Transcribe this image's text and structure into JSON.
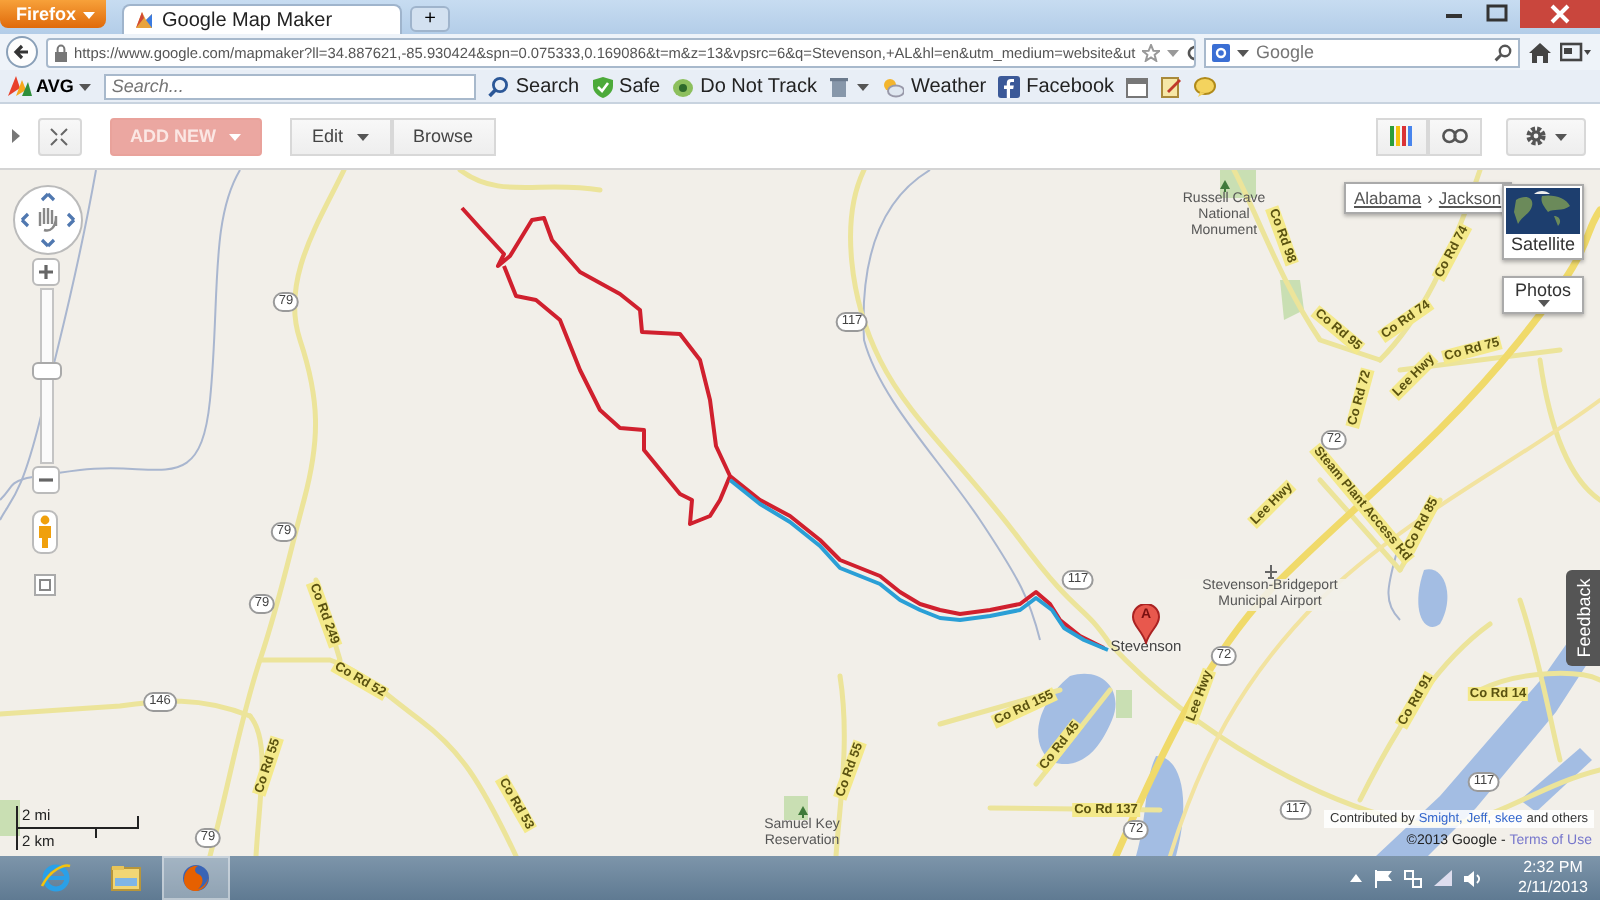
{
  "browser": {
    "app_menu": "Firefox",
    "tabs": [
      {
        "title": "Google Map Maker",
        "selected": true
      }
    ],
    "new_tab": "+",
    "url": "https://www.google.com/mapmaker?ll=34.887621,-85.930424&spn=0.075333,0.169086&t=m&z=13&vpsrc=6&q=Stevenson,+AL&hl=en&utm_medium=website&ut",
    "search_placeholder": "Google"
  },
  "avg_toolbar": {
    "brand": "AVG",
    "search_placeholder": "Search...",
    "items": [
      {
        "kind": "search",
        "label": "Search"
      },
      {
        "kind": "safe",
        "label": "Safe"
      },
      {
        "kind": "tracking",
        "label": "Do Not Track"
      },
      {
        "kind": "trash"
      },
      {
        "kind": "weather",
        "label": "Weather"
      },
      {
        "kind": "facebook",
        "label": "Facebook"
      }
    ]
  },
  "mapmaker_toolbar": {
    "add_new": {
      "label": "ADD NEW",
      "disabled": true
    },
    "modes": [
      {
        "label": "Edit",
        "has_menu": true
      },
      {
        "label": "Browse",
        "has_menu": false
      }
    ]
  },
  "map": {
    "breadcrumb": [
      "Alabama",
      "Jackson"
    ],
    "separator": "›",
    "map_types": [
      {
        "kind": "satellite",
        "label": "Satellite"
      },
      {
        "kind": "photos",
        "label": "Photos"
      }
    ],
    "zoom": {
      "level": 0.55
    },
    "marker": "A",
    "labels": [
      {
        "kind": "park",
        "text": "Russell Cave National Monument"
      },
      {
        "kind": "shield",
        "text": "79"
      },
      {
        "kind": "shield",
        "text": "79"
      },
      {
        "kind": "shield",
        "text": "79"
      },
      {
        "kind": "shield",
        "text": "146"
      },
      {
        "kind": "shield",
        "text": "79"
      },
      {
        "kind": "shield",
        "text": "117"
      },
      {
        "kind": "shield",
        "text": "117"
      },
      {
        "kind": "shield",
        "text": "72"
      },
      {
        "kind": "shield",
        "text": "72"
      },
      {
        "kind": "shield",
        "text": "72"
      },
      {
        "kind": "shield",
        "text": "117"
      },
      {
        "kind": "shield",
        "text": "117"
      },
      {
        "kind": "road",
        "text": "Co Rd 98"
      },
      {
        "kind": "road",
        "text": "Co Rd 74"
      },
      {
        "kind": "road",
        "text": "Co Rd 74"
      },
      {
        "kind": "road",
        "text": "Co Rd 95"
      },
      {
        "kind": "road",
        "text": "Co Rd 72"
      },
      {
        "kind": "road",
        "text": "Lee Hwy"
      },
      {
        "kind": "road",
        "text": "Co Rd 75"
      },
      {
        "kind": "road",
        "text": "Lee Hwy"
      },
      {
        "kind": "road",
        "text": "Steam Plant Access Rd"
      },
      {
        "kind": "road",
        "text": "Co Rd 85"
      },
      {
        "kind": "road",
        "text": "Co Rd 249"
      },
      {
        "kind": "road",
        "text": "Co Rd 52"
      },
      {
        "kind": "road",
        "text": "Co Rd 53"
      },
      {
        "kind": "road",
        "text": "Co Rd 55"
      },
      {
        "kind": "road",
        "text": "Co Rd 55"
      },
      {
        "kind": "road",
        "text": "Co Rd 155"
      },
      {
        "kind": "road",
        "text": "Co Rd 45"
      },
      {
        "kind": "road",
        "text": "Co Rd 137"
      },
      {
        "kind": "road",
        "text": "Lee Hwy"
      },
      {
        "kind": "road",
        "text": "Co Rd 91"
      },
      {
        "kind": "road",
        "text": "Co Rd 14"
      },
      {
        "kind": "place",
        "text": "Stevenson"
      },
      {
        "kind": "airport",
        "text": "Stevenson-Bridgeport Municipal Airport"
      },
      {
        "kind": "park",
        "text": "Samuel Key Reservation"
      }
    ],
    "scale": [
      "2 mi",
      "2 km"
    ],
    "attribution": {
      "prefix": "Contributed by",
      "contributors": [
        "Smight,",
        "Jeff,",
        "skee"
      ],
      "suffix": "and others"
    },
    "copyright": "©2013 Google - ",
    "terms": "Terms of Use",
    "feedback": "Feedback"
  },
  "taskbar": {
    "apps": [
      {
        "kind": "ie",
        "selected": false
      },
      {
        "kind": "explorer",
        "selected": false
      },
      {
        "kind": "firefox",
        "selected": true
      }
    ],
    "time": "2:32 PM",
    "date": "2/11/2013"
  }
}
